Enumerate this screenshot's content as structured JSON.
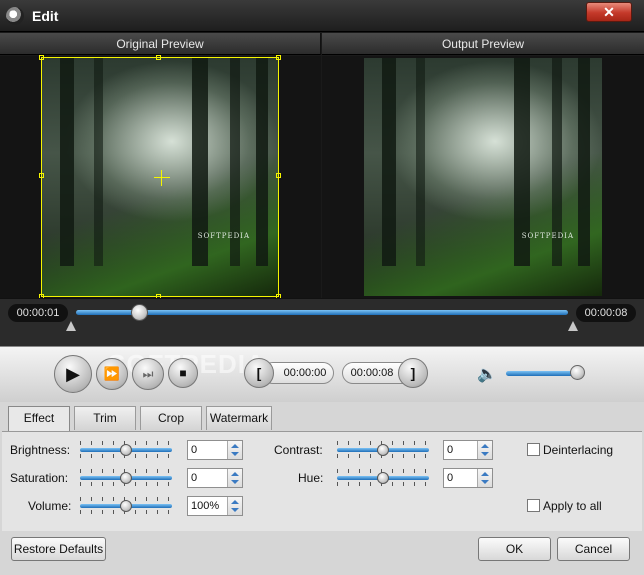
{
  "window": {
    "title": "Edit",
    "close_symbol": "✕"
  },
  "preview": {
    "original_label": "Original Preview",
    "output_label": "Output Preview",
    "watermark_text": "SOFTPEDIA"
  },
  "timeline": {
    "current_time": "00:00:01",
    "total_time": "00:00:08",
    "progress_fraction": 0.13
  },
  "controls": {
    "play_symbol": "▶",
    "fast_forward_symbol": "⏩",
    "next_frame_symbol": "⏭",
    "stop_symbol": "■",
    "set_start_symbol": "[",
    "set_end_symbol": "]",
    "start_time": "00:00:00",
    "end_time": "00:00:08",
    "overlay_watermark": "SOFTPEDIA",
    "volume_symbol": "🔈",
    "volume_level_fraction": 0.95
  },
  "tabs": [
    {
      "label": "Effect",
      "active": true
    },
    {
      "label": "Trim",
      "active": false
    },
    {
      "label": "Crop",
      "active": false
    },
    {
      "label": "Watermark",
      "active": false
    }
  ],
  "effect": {
    "brightness": {
      "label": "Brightness:",
      "value": "0",
      "level": 0.5
    },
    "saturation": {
      "label": "Saturation:",
      "value": "0",
      "level": 0.5
    },
    "volume": {
      "label": "Volume:",
      "value": "100%",
      "level": 0.5
    },
    "contrast": {
      "label": "Contrast:",
      "value": "0",
      "level": 0.5
    },
    "hue": {
      "label": "Hue:",
      "value": "0",
      "level": 0.5
    },
    "deinterlacing_label": "Deinterlacing",
    "apply_all_label": "Apply to all"
  },
  "buttons": {
    "restore_defaults": "Restore Defaults",
    "ok": "OK",
    "cancel": "Cancel"
  },
  "colors": {
    "accent_blue": "#1f6fb8",
    "crop_yellow": "#f5f500",
    "close_red": "#c4392a"
  }
}
